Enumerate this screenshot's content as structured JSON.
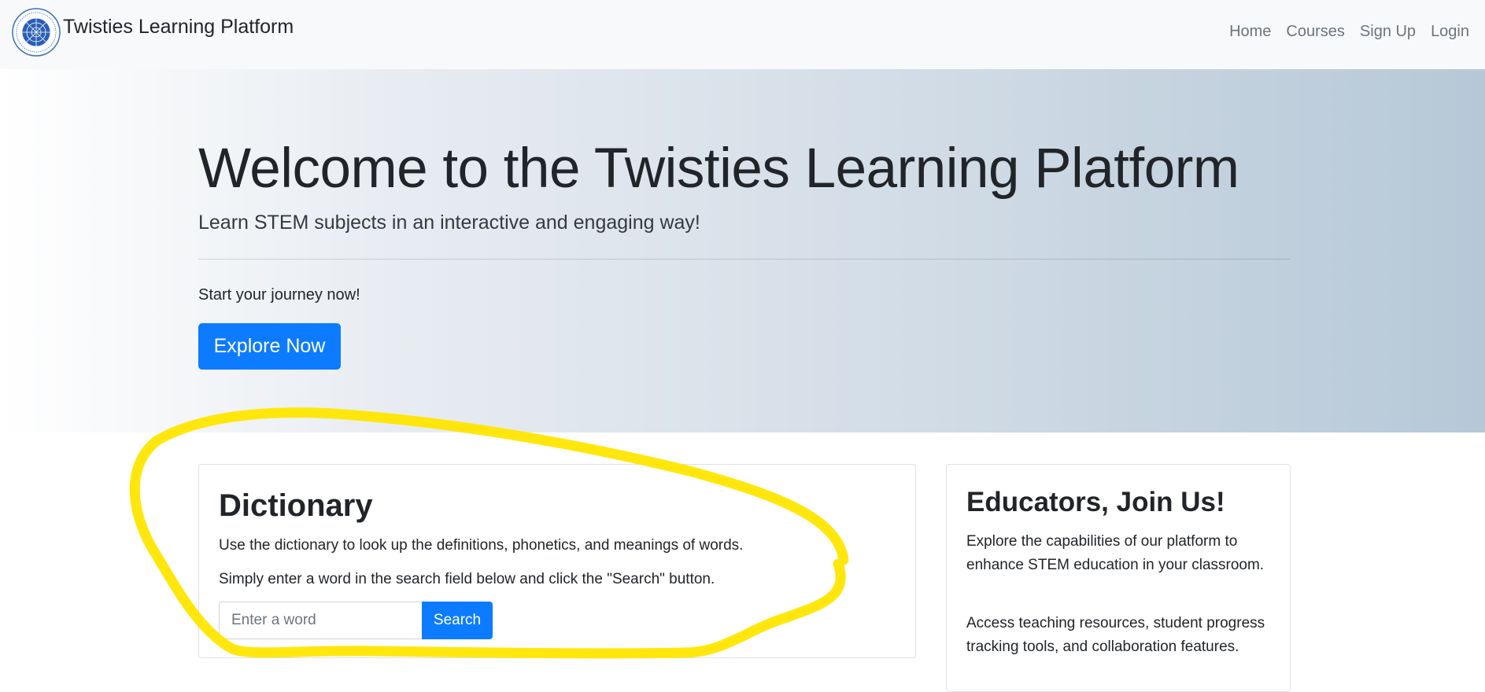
{
  "navbar": {
    "brand": "Twisties Learning Platform",
    "links": [
      "Home",
      "Courses",
      "Sign Up",
      "Login"
    ]
  },
  "hero": {
    "title": "Welcome to the Twisties Learning Platform",
    "lead": "Learn STEM subjects in an interactive and engaging way!",
    "text": "Start your journey now!",
    "button": "Explore Now"
  },
  "dictionary": {
    "title": "Dictionary",
    "text1": "Use the dictionary to look up the definitions, phonetics, and meanings of words.",
    "text2": "Simply enter a word in the search field below and click the \"Search\" button.",
    "placeholder": "Enter a word",
    "button": "Search"
  },
  "educators": {
    "title": "Educators, Join Us!",
    "text1": "Explore the capabilities of our platform to enhance STEM education in your classroom.",
    "text2": "Access teaching resources, student progress tracking tools, and collaboration features."
  },
  "colors": {
    "primary": "#0d7bff",
    "annotation": "#ffe600",
    "navbar_bg": "#f8f9fa"
  }
}
